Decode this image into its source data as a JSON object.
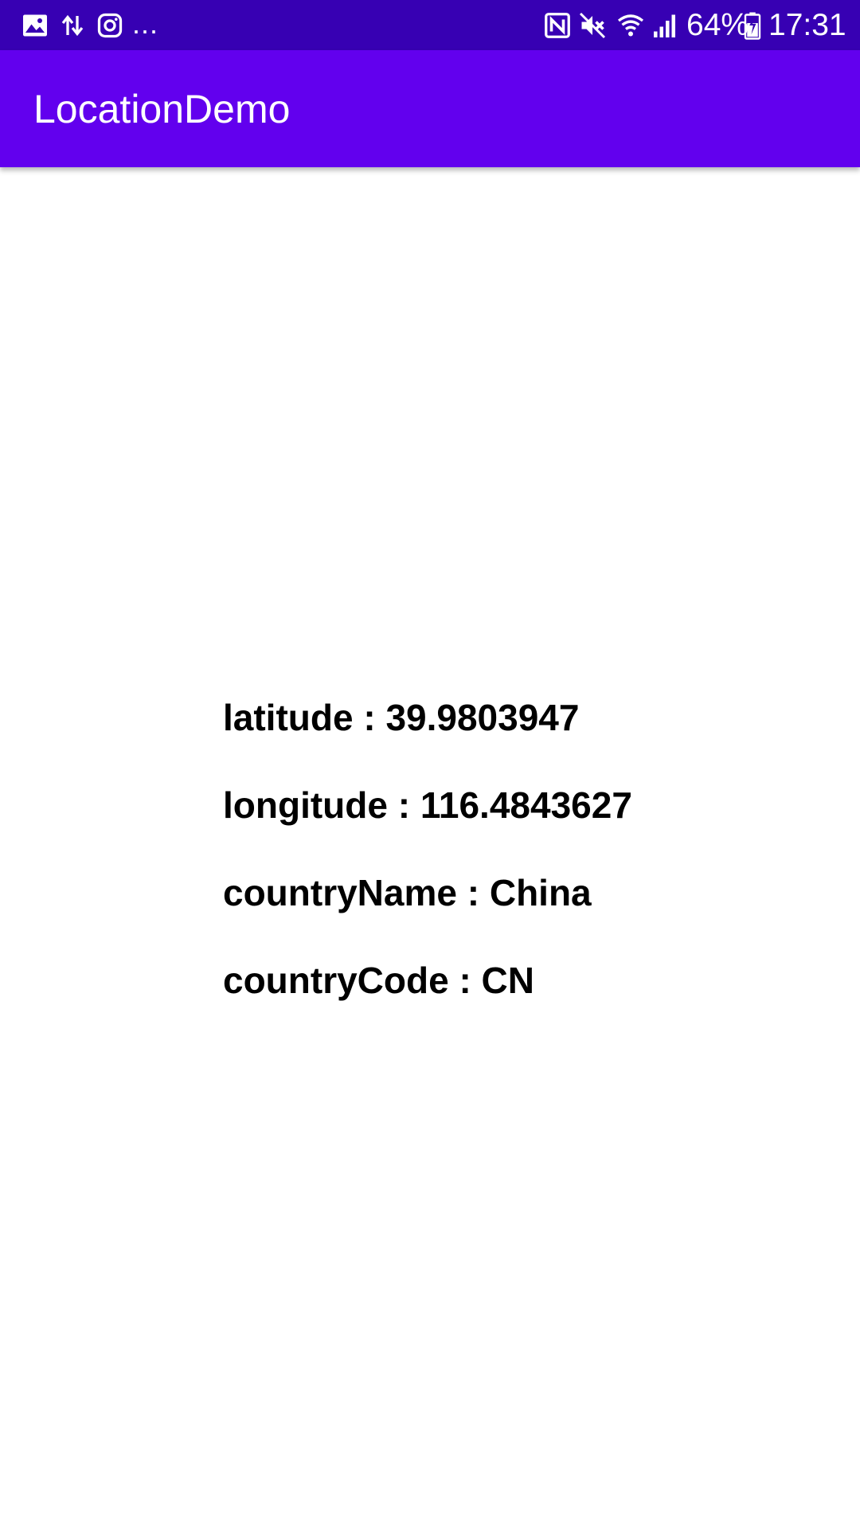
{
  "status_bar": {
    "left_icons": [
      "gallery-icon",
      "data-transfer-icon",
      "instagram-icon"
    ],
    "overflow": "...",
    "right_icons": [
      "nfc-icon",
      "mute-icon",
      "wifi-icon",
      "signal-icon",
      "battery-icon"
    ],
    "battery": "64%",
    "time": "17:31",
    "background": "#3700b3"
  },
  "app_bar": {
    "title": "LocationDemo",
    "background": "#6200ee"
  },
  "location_info": {
    "latitude": "latitude : 39.9803947",
    "longitude": "longitude : 116.4843627",
    "country_name": "countryName : China",
    "country_code": "countryCode : CN"
  }
}
